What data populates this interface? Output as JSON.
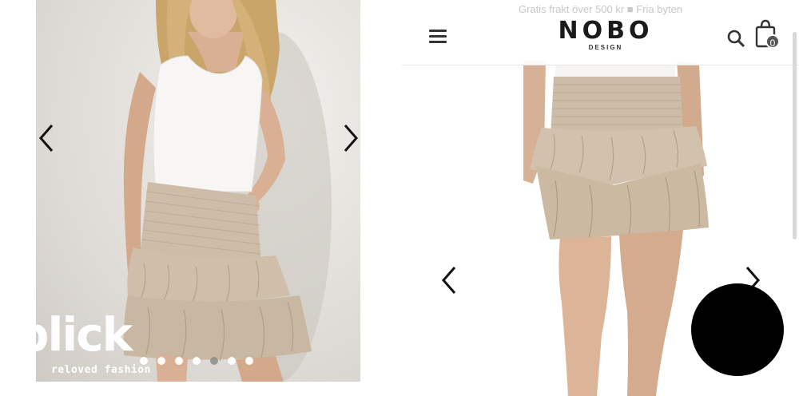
{
  "left": {
    "carousel_dots": 7,
    "active_dot": 4
  },
  "watermark": {
    "logo": "plick",
    "tagline": "reloved fashion"
  },
  "right": {
    "promo": "Gratis frakt över 500 kr ■  Fria byten",
    "brand_name": "NOBO",
    "brand_sub": "DESIGN",
    "cart_count": "0"
  },
  "colors": {
    "skirt": "#cdbca7",
    "top": "#f7f6f4",
    "skin": "#d9b093",
    "hair": "#c9a56a"
  },
  "icons": [
    "chevron-left-icon",
    "chevron-right-icon",
    "menu-icon",
    "search-icon",
    "shopping-bag-icon"
  ]
}
